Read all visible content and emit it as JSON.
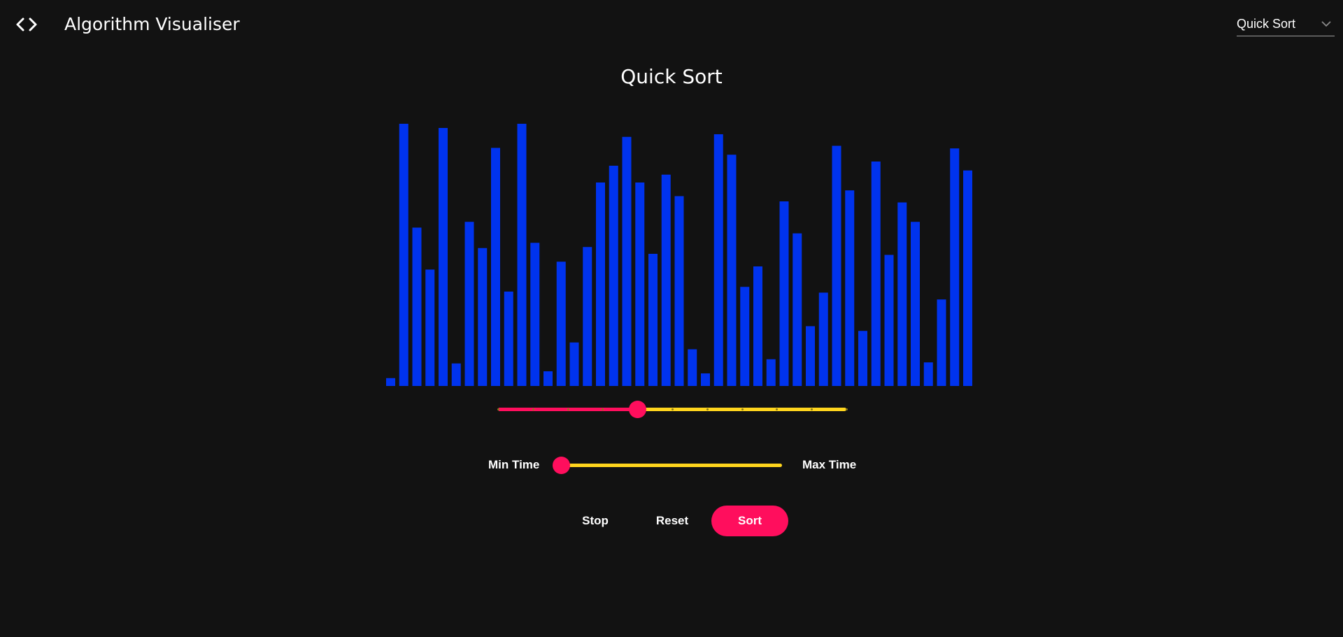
{
  "header": {
    "title": "Algorithm Visualiser",
    "code_icon": "code-icon",
    "algorithm_select": {
      "selected": "Quick Sort",
      "icon": "chevron-down-icon"
    }
  },
  "page_title": "Quick Sort",
  "chart_data": {
    "type": "bar",
    "values": [
      15,
      500,
      302,
      222,
      492,
      43,
      313,
      263,
      454,
      180,
      500,
      273,
      28,
      237,
      83,
      265,
      388,
      420,
      475,
      388,
      252,
      403,
      362,
      70,
      24,
      480,
      441,
      189,
      228,
      51,
      352,
      291,
      114,
      178,
      458,
      373,
      105,
      428,
      250,
      350,
      313,
      45,
      165,
      453,
      411
    ],
    "ylim": [
      0,
      500
    ],
    "bar_color": "#0033ee"
  },
  "controls": {
    "array_size": {
      "value": 0.4,
      "steps": 10
    },
    "speed": {
      "min_label": "Min Time",
      "max_label": "Max Time",
      "value": 0.0
    },
    "buttons": {
      "stop": "Stop",
      "reset": "Reset",
      "sort": "Sort"
    },
    "colors": {
      "accent": "#ff0e5d",
      "track": "#ffd51d",
      "background": "#121212"
    }
  }
}
